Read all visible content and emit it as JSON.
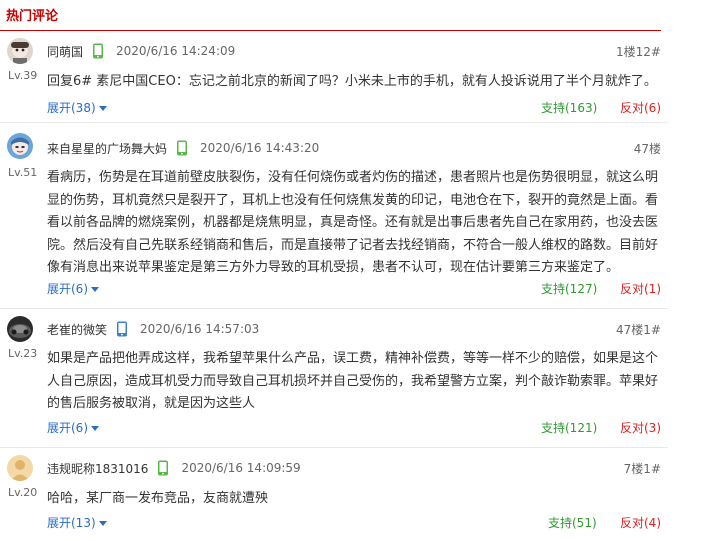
{
  "section": {
    "title": "热门评论"
  },
  "comments": [
    {
      "avatar_icon": "user-avatar-icon",
      "level": "Lv.39",
      "username": "同萌国",
      "device_icon": "phone-icon",
      "device_color": "#58b74a",
      "timestamp": "2020/6/16 14:24:09",
      "floor": "1楼12#",
      "content": "回复6# 素尼中国CEO：忘记之前北京的新闻了吗？小米未上市的手机，就有人投诉说用了半个月就炸了。",
      "expand": "展开(38)",
      "support": "支持(163)",
      "oppose": "反对(6)"
    },
    {
      "avatar_icon": "user-avatar-icon",
      "level": "Lv.51",
      "username": "来自星星的广场舞大妈",
      "device_icon": "phone-icon",
      "device_color": "#58b74a",
      "timestamp": "2020/6/16 14:43:20",
      "floor": "47楼",
      "content": "看病历，伤势是在耳道前壁皮肤裂伤，没有任何烧伤或者灼伤的描述，患者照片也是伤势很明显，就这么明显的伤势，耳机竟然只是裂开了，耳机上也没有任何烧焦发黄的印记，电池仓在下，裂开的竟然是上面。看看以前各品牌的燃烧案例，机器都是烧焦明显，真是奇怪。还有就是出事后患者先自己在家用药，也没去医院。然后没有自己先联系经销商和售后，而是直接带了记者去找经销商，不符合一般人维权的路数。目前好像有消息出来说苹果鉴定是第三方外力导致的耳机受损，患者不认可，现在估计要第三方来鉴定了。",
      "expand": "展开(6)",
      "support": "支持(127)",
      "oppose": "反对(1)"
    },
    {
      "avatar_icon": "user-avatar-icon",
      "level": "Lv.23",
      "username": "老崔的微笑",
      "device_icon": "phone-icon",
      "device_color": "#3b7fd6",
      "timestamp": "2020/6/16 14:57:03",
      "floor": "47楼1#",
      "content": "如果是产品把他弄成这样，我希望苹果什么产品，误工费，精神补偿费，等等一样不少的赔偿，如果是这个人自己原因，造成耳机受力而导致自己耳机损坏并自己受伤的，我希望警方立案，判个敲诈勒索罪。苹果好的售后服务被取消，就是因为这些人",
      "expand": "展开(6)",
      "support": "支持(121)",
      "oppose": "反对(3)"
    },
    {
      "avatar_icon": "user-avatar-icon",
      "level": "Lv.20",
      "username": "违规昵称1831016",
      "device_icon": "phone-icon",
      "device_color": "#58b74a",
      "timestamp": "2020/6/16 14:09:59",
      "floor": "7楼1#",
      "content": "哈哈，某厂商一发布竞品，友商就遭殃",
      "expand": "展开(13)",
      "support": "支持(51)",
      "oppose": "反对(4)"
    }
  ]
}
